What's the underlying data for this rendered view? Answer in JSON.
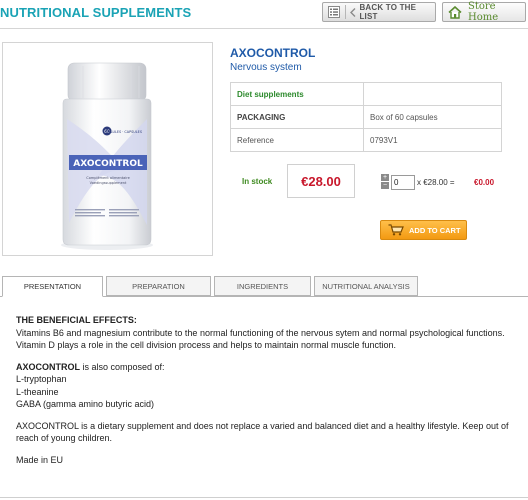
{
  "header": {
    "title": "NUTRITIONAL SUPPLEMENTS",
    "back_label": "BACK TO THE LIST",
    "home_label": "Store Home"
  },
  "product": {
    "name": "AXOCONTROL",
    "subtitle": "Nervous system",
    "image_brand": "AXOCONTROL",
    "image_caption": "Complément alimentaire Voedingssupplement",
    "image_badge": "60 GÉLULES · CAPSULES",
    "category": "Diet supplements",
    "packaging_label": "PACKAGING",
    "packaging_value": "Box of 60 capsules",
    "reference_label": "Reference",
    "reference_value": "0793V1",
    "stock": "In stock",
    "price": "€28.00",
    "quantity": "0",
    "unit_expr": "x €28.00 =",
    "total": "€0.00",
    "add_to_cart": "ADD TO CART"
  },
  "tabs": [
    "PRESENTATION",
    "PREPARATION",
    "INGREDIENTS",
    "NUTRITIONAL ANALYSIS"
  ],
  "presentation": {
    "heading": "THE BENEFICIAL EFFECTS:",
    "line1": "Vitamins B6 and magnesium contribute to the normal functioning of the nervous sytem and normal psychological functions.",
    "line2": "Vitamin D plays a role in the cell division process and helps to maintain normal muscle function.",
    "composed_name": "AXOCONTROL",
    "composed_text": " is also composed of:",
    "ingredients": [
      "L-tryptophan",
      "L-theanine",
      "GABA (gamma amino butyric acid)"
    ],
    "disclaimer": "AXOCONTROL is a dietary supplement and does not replace a varied and balanced diet and a healthy lifestyle. Keep out of reach of young children.",
    "origin": "Made in EU"
  },
  "colors": {
    "title": "#1aa3b5",
    "product_name": "#1f5aa8",
    "price": "#c8172b",
    "stock": "#3e8a1f",
    "cart": "#f39a12"
  }
}
